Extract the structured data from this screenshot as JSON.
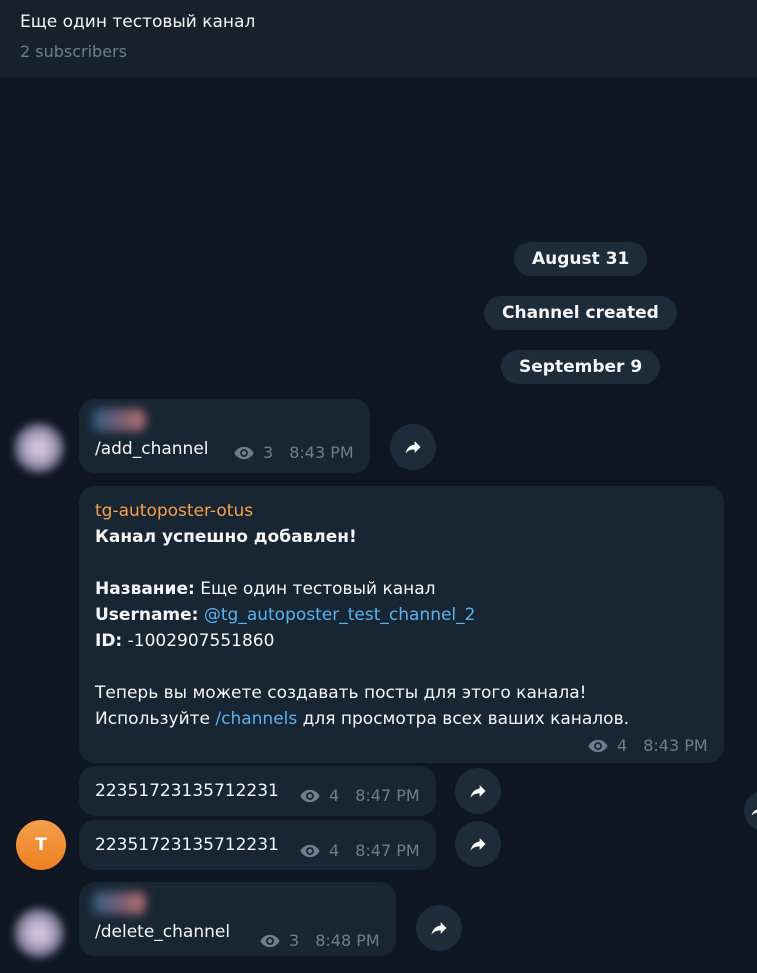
{
  "header": {
    "title": "Еще один тестовый канал",
    "subtitle": "2 subscribers"
  },
  "service_messages": [
    "August 31",
    "Channel created",
    "September 9"
  ],
  "messages": [
    {
      "text": "/add_channel",
      "views": "3",
      "time": "8:43 PM"
    },
    {
      "sender": "tg-autoposter-otus",
      "line1": "Канал успешно добавлен!",
      "name_label": "Название:",
      "name_value": " Еще один тестовый канал",
      "username_label": "Username:",
      "username_value": "@tg_autoposter_test_channel_2",
      "id_label": "ID:",
      "id_value": " -1002907551860",
      "line2": "Теперь вы можете создавать посты для этого канала!",
      "line3_prefix": "Используйте ",
      "line3_link": "/channels",
      "line3_suffix": " для просмотра всех ваших каналов.",
      "views": "4",
      "time": "8:43 PM"
    },
    {
      "text": "22351723135712231",
      "views": "4",
      "time": "8:47 PM"
    },
    {
      "text": "22351723135712231",
      "views": "4",
      "time": "8:47 PM"
    },
    {
      "text": "/delete_channel",
      "views": "3",
      "time": "8:48 PM"
    }
  ],
  "avatar_letter": "T",
  "icons": [
    "eye-icon",
    "forward-icon"
  ],
  "colors": {
    "background": "#0e1621",
    "bubble": "#182533",
    "accent_sender": "#f4a04a",
    "link": "#5bb1ef",
    "meta": "#6d7f8f"
  }
}
